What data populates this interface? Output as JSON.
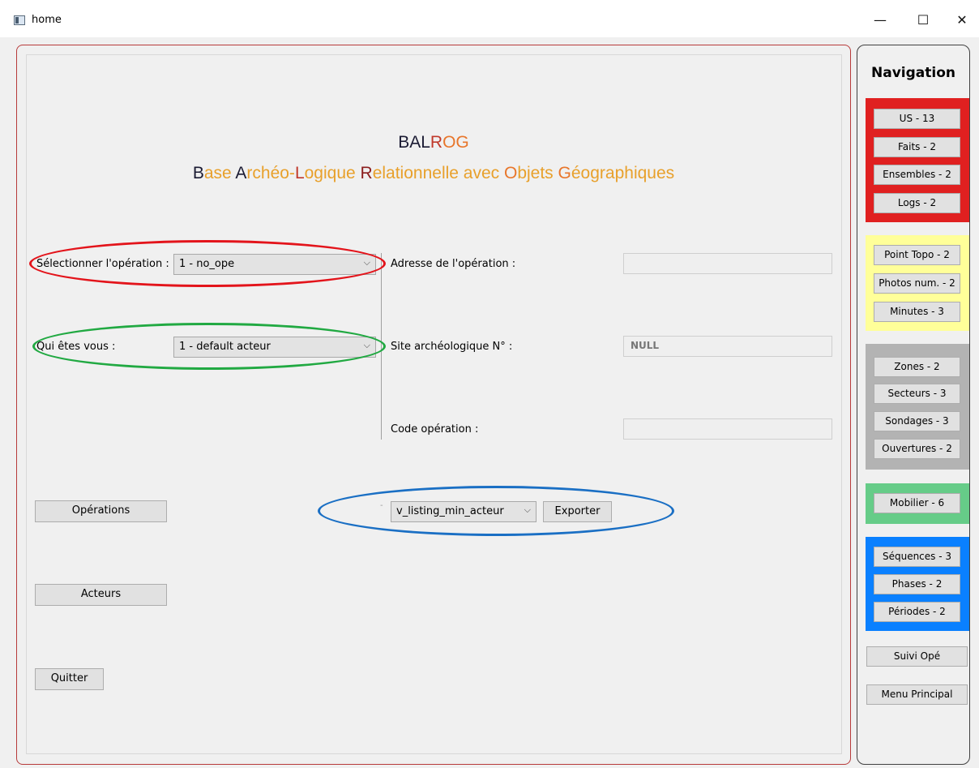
{
  "window": {
    "title": "home",
    "controls": {
      "minimize": "—",
      "maximize": "☐",
      "close": "✕"
    }
  },
  "brand": {
    "short": [
      {
        "text": "BAL",
        "color": "#1b1b33"
      },
      {
        "text": "R",
        "color": "#c0392b"
      },
      {
        "text": "OG",
        "color": "#e8762b"
      }
    ],
    "long": [
      {
        "text": "B",
        "color": "#1b1b33"
      },
      {
        "text": "ase ",
        "color": "#e8a02b"
      },
      {
        "text": "A",
        "color": "#1b1b33"
      },
      {
        "text": "rchéo-",
        "color": "#e8a02b"
      },
      {
        "text": "L",
        "color": "#c0392b"
      },
      {
        "text": "ogique ",
        "color": "#e8a02b"
      },
      {
        "text": "R",
        "color": "#8b1e1e"
      },
      {
        "text": "elationnelle avec ",
        "color": "#e8a02b"
      },
      {
        "text": "O",
        "color": "#e8762b"
      },
      {
        "text": "bjets ",
        "color": "#e8a02b"
      },
      {
        "text": "G",
        "color": "#e8762b"
      },
      {
        "text": "éographiques",
        "color": "#e8a02b"
      }
    ]
  },
  "form": {
    "operation_label": "Sélectionner l'opération :",
    "operation_value": "1 - no_ope",
    "actor_label": "Qui êtes vous :",
    "actor_value": "1 - default acteur",
    "address_label": "Adresse de l'opération :",
    "address_value": "",
    "site_label": "Site archéologique N° :",
    "site_value": "NULL",
    "code_label": "Code opération :",
    "code_value": ""
  },
  "export": {
    "dash": "-",
    "view_value": "v_listing_min_acteur",
    "button": "Exporter"
  },
  "buttons": {
    "operations": "Opérations",
    "actors": "Acteurs",
    "quit": "Quitter"
  },
  "nav": {
    "title": "Navigation",
    "red": [
      "US - 13",
      "Faits - 2",
      "Ensembles - 2",
      "Logs - 2"
    ],
    "yellow": [
      "Point Topo - 2",
      "Photos num. - 2",
      "Minutes - 3"
    ],
    "gray": [
      "Zones - 2",
      "Secteurs - 3",
      "Sondages - 3",
      "Ouvertures - 2"
    ],
    "green": [
      "Mobilier - 6"
    ],
    "blue": [
      "Séquences - 3",
      "Phases - 2",
      "Périodes - 2"
    ],
    "suivi": "Suivi Opé",
    "menu": "Menu Principal"
  },
  "colors": {
    "highlight_operation": "#e3141b",
    "highlight_actor": "#21a942",
    "highlight_export": "#1a6fc4",
    "nav_red": "#e02020",
    "nav_yellow": "#ffff99",
    "nav_gray": "#b3b3b3",
    "nav_green": "#66cc88",
    "nav_blue": "#0a80ff"
  }
}
